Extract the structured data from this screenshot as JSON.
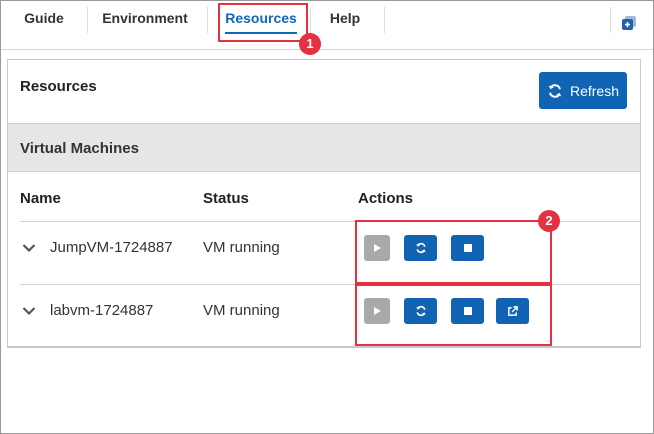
{
  "tabs": [
    {
      "label": "Guide"
    },
    {
      "label": "Environment"
    },
    {
      "label": "Resources",
      "active": true
    },
    {
      "label": "Help"
    }
  ],
  "callouts": {
    "one": "1",
    "two": "2"
  },
  "resources": {
    "title": "Resources",
    "refresh_label": "Refresh",
    "section_title": "Virtual Machines",
    "columns": {
      "name": "Name",
      "status": "Status",
      "actions": "Actions"
    },
    "vms": [
      {
        "name": "JumpVM-1724887",
        "status": "VM running",
        "actions": [
          "start",
          "restart",
          "stop"
        ]
      },
      {
        "name": "labvm-1724887",
        "status": "VM running",
        "actions": [
          "start",
          "restart",
          "stop",
          "open"
        ]
      }
    ]
  },
  "colors": {
    "accent": "#1164b4",
    "callout": "#e53140",
    "disabled": "#a9a9a9",
    "header_bg": "#e6e6e6"
  },
  "icons": {
    "corner": "popout-window-icon",
    "expand": "chevron-down-icon",
    "refresh": "refresh-icon",
    "start": "play-icon",
    "restart": "refresh-icon",
    "stop": "stop-icon",
    "open": "external-link-icon"
  }
}
